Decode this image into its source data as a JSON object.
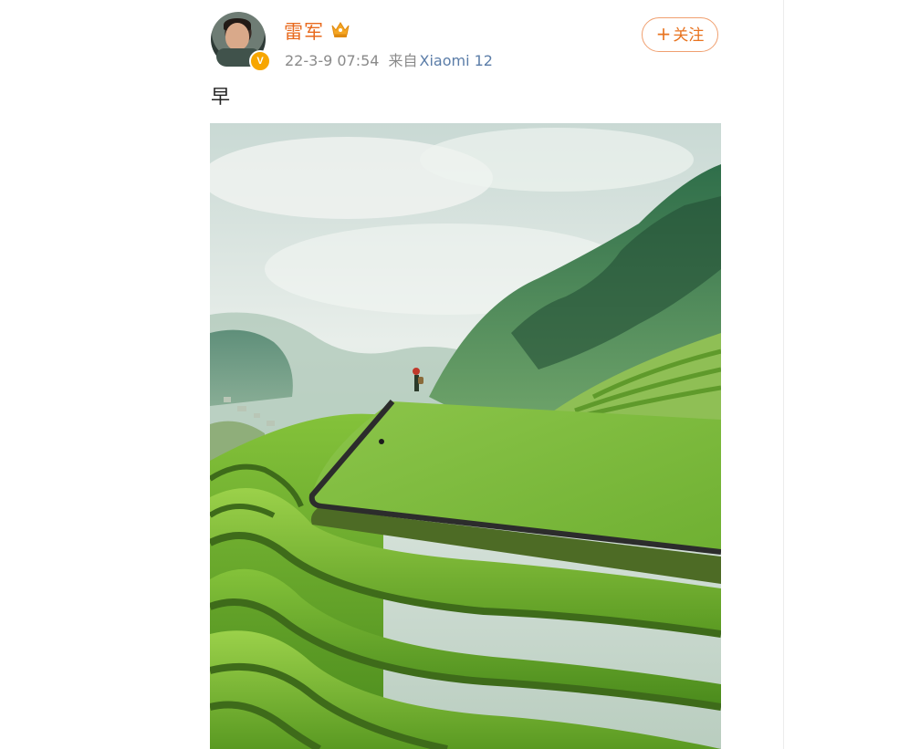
{
  "post": {
    "author": {
      "name": "雷军",
      "verified_badge": "V",
      "avatar_icon": "user-avatar",
      "crown_icon": "crown-icon"
    },
    "timestamp": "22-3-9 07:54",
    "source_prefix": "来自",
    "source_device": "Xiaomi 12",
    "follow_button": {
      "plus": "+",
      "label": "关注"
    },
    "text": "早",
    "image": {
      "type": "photo"
    }
  },
  "colors": {
    "author_name": "#e86a1e",
    "follow_button": "#e8731f",
    "verified_badge": "#f7a600",
    "meta_text": "#8a8a8a",
    "device_link": "#5b7da8"
  }
}
